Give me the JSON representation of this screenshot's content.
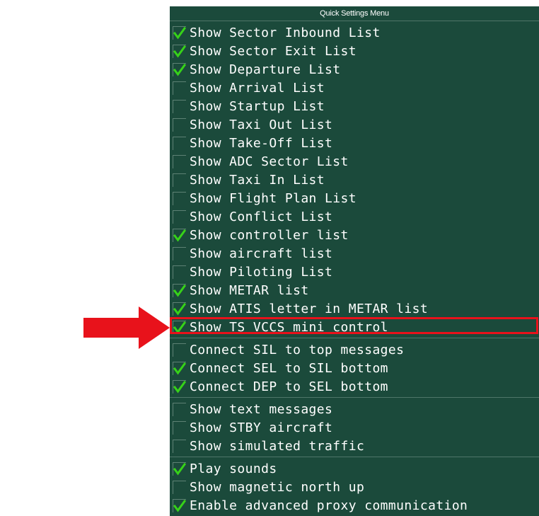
{
  "menu": {
    "title": "Quick Settings Menu",
    "check_color": "#37d219",
    "background_color": "#1b4a3b",
    "highlight_color": "#e8121b",
    "groups": [
      [
        {
          "label": "Show Sector Inbound List",
          "checked": true
        },
        {
          "label": "Show Sector Exit List",
          "checked": true
        },
        {
          "label": "Show Departure List",
          "checked": true
        },
        {
          "label": "Show Arrival List",
          "checked": false
        },
        {
          "label": "Show Startup List",
          "checked": false
        },
        {
          "label": "Show Taxi Out List",
          "checked": false
        },
        {
          "label": "Show Take-Off List",
          "checked": false
        },
        {
          "label": "Show ADC Sector List",
          "checked": false
        },
        {
          "label": "Show Taxi In List",
          "checked": false
        },
        {
          "label": "Show Flight Plan List",
          "checked": false
        },
        {
          "label": "Show Conflict List",
          "checked": false
        },
        {
          "label": "Show controller list",
          "checked": true
        },
        {
          "label": "Show aircraft list",
          "checked": false
        },
        {
          "label": "Show Piloting List",
          "checked": false
        },
        {
          "label": "Show METAR list",
          "checked": true
        },
        {
          "label": "Show ATIS letter in METAR list",
          "checked": true
        },
        {
          "label": "Show TS VCCS mini control",
          "checked": true,
          "highlighted": true
        }
      ],
      [
        {
          "label": "Connect SIL to top messages",
          "checked": false
        },
        {
          "label": "Connect SEL to SIL bottom",
          "checked": true
        },
        {
          "label": "Connect DEP to SEL bottom",
          "checked": true
        }
      ],
      [
        {
          "label": "Show text messages",
          "checked": false
        },
        {
          "label": "Show STBY aircraft",
          "checked": false
        },
        {
          "label": "Show simulated traffic",
          "checked": false
        }
      ],
      [
        {
          "label": "Play sounds",
          "checked": true
        },
        {
          "label": "Show magnetic north up",
          "checked": false
        },
        {
          "label": "Enable advanced proxy communication",
          "checked": true
        }
      ]
    ]
  },
  "annotation": {
    "icon": "red-arrow-icon",
    "color": "#e8121b"
  }
}
